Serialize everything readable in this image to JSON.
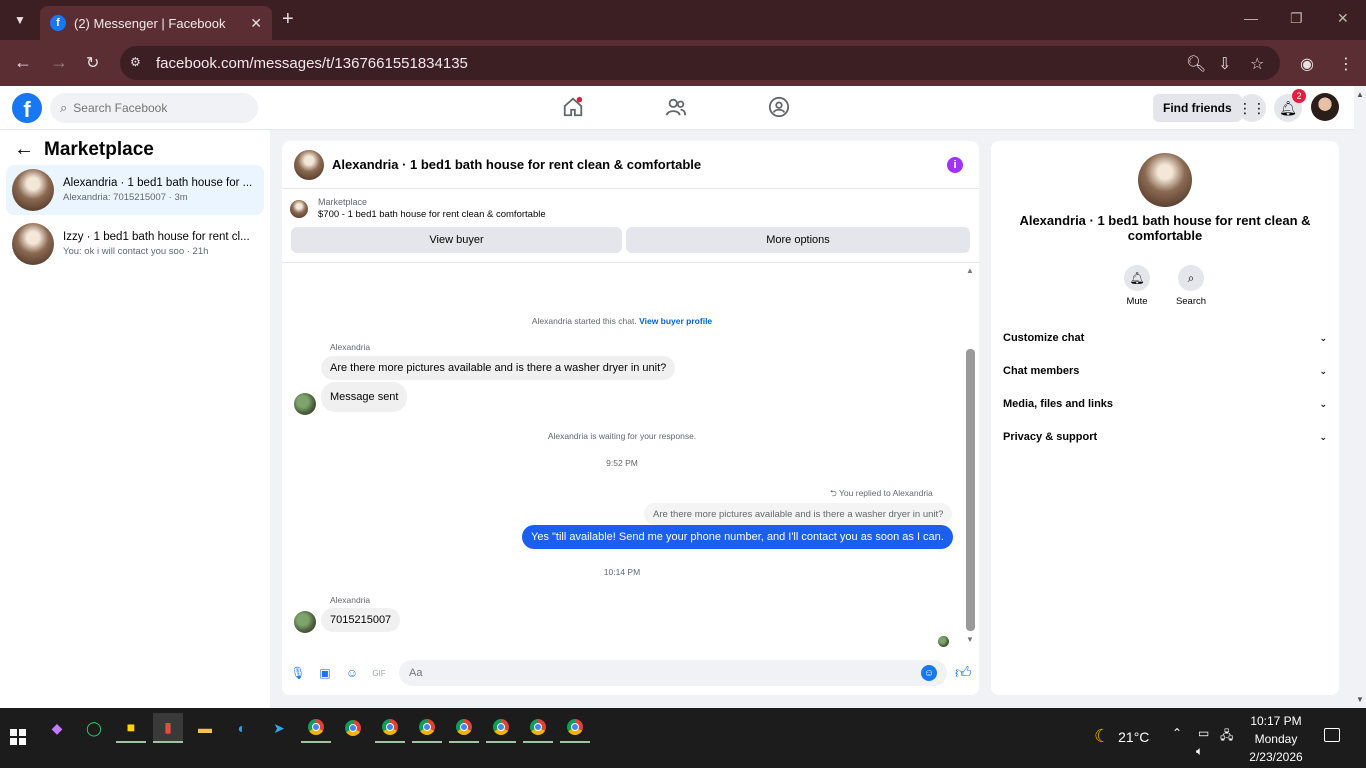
{
  "browser": {
    "tab_title": "(2) Messenger | Facebook",
    "url": "facebook.com/messages/t/1367661551834135"
  },
  "header": {
    "search_placeholder": "Search Facebook",
    "find_friends": "Find friends",
    "notification_count": "2"
  },
  "sidebar": {
    "title": "Marketplace",
    "conversations": [
      {
        "name": "Alexandria · 1 bed1 bath house for ...",
        "preview": "Alexandria: 7015215007 · 3m"
      },
      {
        "name": "Izzy · 1 bed1 bath house for rent cl...",
        "preview": "You: ok i will contact you soo · 21h"
      }
    ]
  },
  "chat": {
    "title": "Alexandria · 1 bed1 bath house for rent clean & comfortable",
    "marketplace_label": "Marketplace",
    "listing": "$700 - 1 bed1 bath house for rent clean & comfortable",
    "view_buyer": "View buyer",
    "more_options": "More options",
    "started_text": "Alexandria started this chat.",
    "view_buyer_profile": "View buyer profile",
    "sender1": "Alexandria",
    "msg1": "Are there more pictures available and is there a washer dryer in unit?",
    "msg2": "Message sent",
    "waiting": "Alexandria is waiting for your response.",
    "time1": "9:52 PM",
    "replied": "You replied to Alexandria",
    "quoted": "Are there more pictures available and is there a washer dryer in unit?",
    "reply": "Yes \"till available! Send me your phone number, and I'll contact you as soon as I can.",
    "time2": "10:14 PM",
    "sender2": "Alexandria",
    "msg3": "7015215007",
    "composer_placeholder": "Aa"
  },
  "rightpanel": {
    "name": "Alexandria · 1 bed1 bath house for rent clean & comfortable",
    "mute": "Mute",
    "search": "Search",
    "rows": [
      "Customize chat",
      "Chat members",
      "Media, files and links",
      "Privacy & support"
    ]
  },
  "taskbar": {
    "temperature": "21°C",
    "time": "10:17 PM",
    "day": "Monday",
    "date": "2/23/2026"
  },
  "colors": {
    "fb_blue": "#1877f2",
    "outgoing_bubble": "#1a5ff0",
    "info_purple": "#a033ff",
    "browser_frame": "#5a2e33"
  }
}
